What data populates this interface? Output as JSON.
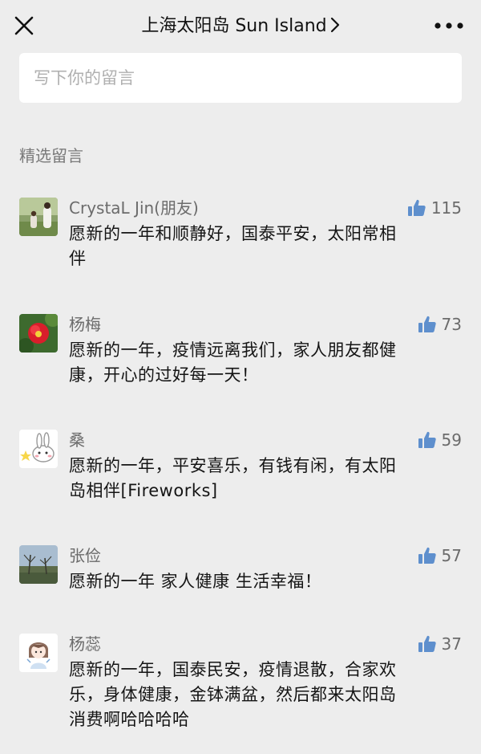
{
  "header": {
    "title": "上海太阳岛 Sun Island",
    "close_icon": "close-icon",
    "more_icon": "more-icon",
    "chevron_icon": "chevron-right-icon"
  },
  "input": {
    "placeholder": "写下你的留言"
  },
  "section": {
    "title": "精选留言"
  },
  "colors": {
    "background": "#ededed",
    "like_icon": "#5e8fcd",
    "author": "#6b6b6b"
  },
  "comments": [
    {
      "author": "CrystaL Jin(朋友)",
      "likes": "115",
      "line1": "愿新的一年和顺静好，国泰平安，太阳常相",
      "line2": "伴",
      "line3": ""
    },
    {
      "author": "杨梅",
      "likes": "73",
      "line1": "愿新的一年，疫情远离我们，家人朋友都健",
      "line2": "康，开心的过好每一天！",
      "line3": ""
    },
    {
      "author": "桑",
      "likes": "59",
      "line1": "愿新的一年，平安喜乐，有钱有闲，有太阳",
      "line2": "岛相伴[Fireworks]",
      "line3": ""
    },
    {
      "author": "张俭",
      "likes": "57",
      "line1": "愿新的一年 家人健康 生活幸福！",
      "line2": "",
      "line3": ""
    },
    {
      "author": "杨蕊",
      "likes": "37",
      "line1": "愿新的一年，国泰民安，疫情退散，合家欢",
      "line2": "乐，身体健康，金钵满盆，然后都来太阳岛",
      "line3": "消费啊哈哈哈哈"
    }
  ]
}
